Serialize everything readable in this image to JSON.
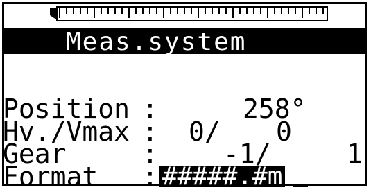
{
  "title": "Meas.system",
  "rows": {
    "position": {
      "label": "Position",
      "colon": ":",
      "value": "258°"
    },
    "hv_vmax": {
      "label": "Hv./Vmax",
      "colon": ":",
      "value_a": "0/",
      "value_b": "0"
    },
    "gear": {
      "label": "Gear",
      "colon": ":",
      "value_a": "-1/",
      "value_b": "1"
    },
    "format": {
      "label": "Format",
      "colon": ":",
      "value": "#####.#m"
    }
  },
  "colors": {
    "foreground": "#000000",
    "background": "#ffffff"
  }
}
